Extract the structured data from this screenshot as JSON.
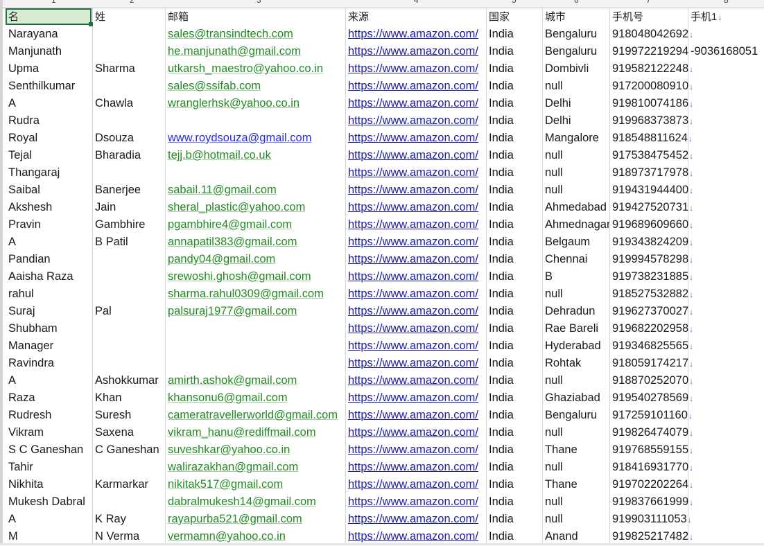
{
  "column_letters": [
    "1",
    "2",
    "3",
    "4",
    "5",
    "6",
    "7",
    "8"
  ],
  "headers": [
    "名",
    "姓",
    "邮箱",
    "来源",
    "国家",
    "城市",
    "手机号",
    "手机1"
  ],
  "link_arrow": "↓",
  "rows": [
    {
      "first": "Narayana",
      "last": "",
      "email": "sales@transindtech.com",
      "source": "https://www.amazon.com/",
      "country": "India",
      "city": "Bengaluru",
      "phone": "918048042692",
      "phone1": ""
    },
    {
      "first": "Manjunath",
      "last": "",
      "email": "he.manjunath@gmail.com",
      "source": "https://www.amazon.com/",
      "country": "India",
      "city": "Bengaluru",
      "phone": "919972219294",
      "phone1": "-9036168051"
    },
    {
      "first": "Upma",
      "last": "Sharma",
      "email": "utkarsh_maestro@yahoo.co.in",
      "source": "https://www.amazon.com/",
      "country": "India",
      "city": "Dombivli",
      "phone": "919582122248",
      "phone1": ""
    },
    {
      "first": "Senthilkumar",
      "last": "",
      "email": "sales@ssifab.com",
      "source": "https://www.amazon.com/",
      "country": "India",
      "city": "null",
      "phone": "917200080910",
      "phone1": ""
    },
    {
      "first": "A",
      "last": "Chawla",
      "email": "wranglerhsk@yahoo.co.in",
      "source": "https://www.amazon.com/",
      "country": "India",
      "city": "Delhi",
      "phone": "919810074186",
      "phone1": ""
    },
    {
      "first": "Rudra",
      "last": "",
      "email": "",
      "source": "https://www.amazon.com/",
      "country": "India",
      "city": "Delhi",
      "phone": "919968373873",
      "phone1": ""
    },
    {
      "first": "Royal",
      "last": "Dsouza",
      "email": "www.roydsouza@gmail.com",
      "email_style": "blue",
      "source": "https://www.amazon.com/",
      "country": "India",
      "city": "Mangalore",
      "phone": "918548811624",
      "phone1": ""
    },
    {
      "first": "Tejal",
      "last": "Bharadia",
      "email": "tejj.b@hotmail.co.uk",
      "source": "https://www.amazon.com/",
      "country": "India",
      "city": "null",
      "phone": "917538475452",
      "phone1": ""
    },
    {
      "first": "Thangaraj",
      "last": "",
      "email": "",
      "source": "https://www.amazon.com/",
      "country": "India",
      "city": "null",
      "phone": "918973717978",
      "phone1": ""
    },
    {
      "first": "Saibal",
      "last": "Banerjee",
      "email": "sabail.11@gmail.com",
      "source": "https://www.amazon.com/",
      "country": "India",
      "city": "null",
      "phone": "919431944400",
      "phone1": ""
    },
    {
      "first": "Akshesh",
      "last": "Jain",
      "email": "sheral_plastic@yahoo.com",
      "source": "https://www.amazon.com/",
      "country": "India",
      "city": "Ahmedabad",
      "phone": "919427520731",
      "phone1": ""
    },
    {
      "first": "Pravin",
      "last": "Gambhire",
      "email": "pgambhire4@gmail.com",
      "source": "https://www.amazon.com/",
      "country": "India",
      "city": "Ahmednagar",
      "phone": "919689609660",
      "phone1": ""
    },
    {
      "first": "A",
      "last": "B Patil",
      "email": "annapatil383@gmail.com",
      "source": "https://www.amazon.com/",
      "country": "India",
      "city": "Belgaum",
      "phone": "919343824209",
      "phone1": ""
    },
    {
      "first": "Pandian",
      "last": "",
      "email": "pandy04@gmail.com",
      "source": "https://www.amazon.com/",
      "country": "India",
      "city": "Chennai",
      "phone": "919994578298",
      "phone1": ""
    },
    {
      "first": "Aaisha Raza",
      "last": "",
      "email": "srewoshi.ghosh@gmail.com",
      "source": "https://www.amazon.com/",
      "country": "India",
      "city": "B",
      "phone": "919738231885",
      "phone1": ""
    },
    {
      "first": "rahul",
      "last": "",
      "email": "sharma.rahul0309@gmail.com",
      "source": "https://www.amazon.com/",
      "country": "India",
      "city": "null",
      "phone": "918527532882",
      "phone1": ""
    },
    {
      "first": "Suraj",
      "last": "Pal",
      "email": "palsuraj1977@gmail.com",
      "source": "https://www.amazon.com/",
      "country": "India",
      "city": "Dehradun",
      "phone": "919627370027",
      "phone1": ""
    },
    {
      "first": "Shubham",
      "last": "",
      "email": "",
      "source": "https://www.amazon.com/",
      "country": "India",
      "city": "Rae Bareli",
      "phone": "919682202958",
      "phone1": ""
    },
    {
      "first": "Manager",
      "last": "",
      "email": "",
      "source": "https://www.amazon.com/",
      "country": "India",
      "city": "Hyderabad",
      "phone": "919346825565",
      "phone1": ""
    },
    {
      "first": "Ravindra",
      "last": "",
      "email": "",
      "source": "https://www.amazon.com/",
      "country": "India",
      "city": "Rohtak",
      "phone": "918059174217",
      "phone1": ""
    },
    {
      "first": "A",
      "last": "Ashokkumar",
      "email": "amirth.ashok@gmail.com",
      "source": "https://www.amazon.com/",
      "country": "India",
      "city": "null",
      "phone": "918870252070",
      "phone1": ""
    },
    {
      "first": "Raza",
      "last": "Khan",
      "email": "khansonu6@gmail.com",
      "source": "https://www.amazon.com/",
      "country": "India",
      "city": "Ghaziabad",
      "phone": "919540278569",
      "phone1": ""
    },
    {
      "first": "Rudresh",
      "last": "Suresh",
      "email": "cameratravellerworld@gmail.com",
      "source": "https://www.amazon.com/",
      "country": "India",
      "city": "Bengaluru",
      "phone": "917259101160",
      "phone1": ""
    },
    {
      "first": "Vikram",
      "last": "Saxena",
      "email": "vikram_hanu@rediffmail.com",
      "source": "https://www.amazon.com/",
      "country": "India",
      "city": "null",
      "phone": "919826474079",
      "phone1": ""
    },
    {
      "first": "S C Ganeshan",
      "last": "C Ganeshan",
      "email": "suveshkar@yahoo.co.in",
      "source": "https://www.amazon.com/",
      "country": "India",
      "city": "Thane",
      "phone": "919768559155",
      "phone1": ""
    },
    {
      "first": "Tahir",
      "last": "",
      "email": "walirazakhan@gmail.com",
      "source": "https://www.amazon.com/",
      "country": "India",
      "city": "null",
      "phone": "918416931770",
      "phone1": ""
    },
    {
      "first": "Nikhita",
      "last": "Karmarkar",
      "email": "nikitak517@gmail.com",
      "source": "https://www.amazon.com/",
      "country": "India",
      "city": "Thane",
      "phone": "919702202264",
      "phone1": ""
    },
    {
      "first": "Mukesh Dabral",
      "last": "",
      "email": "dabralmukesh14@gmail.com",
      "source": "https://www.amazon.com/",
      "country": "India",
      "city": "null",
      "phone": "919837661999",
      "phone1": ""
    },
    {
      "first": "A",
      "last": "K Ray",
      "email": "rayapurba521@gmail.com",
      "source": "https://www.amazon.com/",
      "country": "India",
      "city": "null",
      "phone": "919903111053",
      "phone1": ""
    },
    {
      "first": "M",
      "last": "N Verma",
      "email": "vermamn@yahoo.co.in",
      "source": "https://www.amazon.com/",
      "country": "India",
      "city": "Anand",
      "phone": "919825217482",
      "phone1": ""
    }
  ]
}
